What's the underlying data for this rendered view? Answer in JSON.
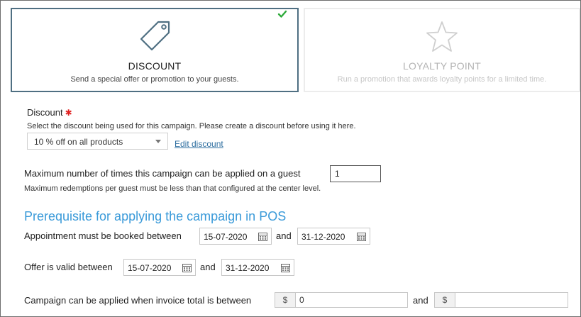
{
  "cards": {
    "discount": {
      "title": "DISCOUNT",
      "description": "Send a special offer or promotion to your guests.",
      "icon": "tag-icon",
      "selected": true
    },
    "loyalty": {
      "title": "LOYALTY POINT",
      "description": "Run a promotion that awards loyalty points for a limited time.",
      "icon": "star-icon",
      "selected": false
    }
  },
  "discount_field": {
    "label": "Discount",
    "required_mark": "✱",
    "hint": "Select the discount being used for this campaign. Please create a discount before using it here.",
    "selected_value": "10 % off on all products",
    "edit_link": "Edit discount"
  },
  "max_per_guest": {
    "label": "Maximum number of times this campaign can be applied on a guest",
    "value": "1",
    "hint": "Maximum redemptions per guest must be less than that configured at the center level."
  },
  "prerequisite": {
    "title": "Prerequisite for applying the campaign in POS",
    "appointment_label": "Appointment must be booked between",
    "appointment_from": "15-07-2020",
    "appointment_to": "31-12-2020",
    "and_label": "and",
    "offer_label": "Offer is valid between",
    "offer_from": "15-07-2020",
    "offer_to": "31-12-2020",
    "invoice_label": "Campaign can be applied when invoice total is between",
    "currency_symbol": "$",
    "invoice_min": "0",
    "invoice_max": ""
  },
  "colors": {
    "accent": "#3a9ad9",
    "selected_border": "#4f6f82",
    "check": "#2eaa3a",
    "required": "#e02020"
  }
}
